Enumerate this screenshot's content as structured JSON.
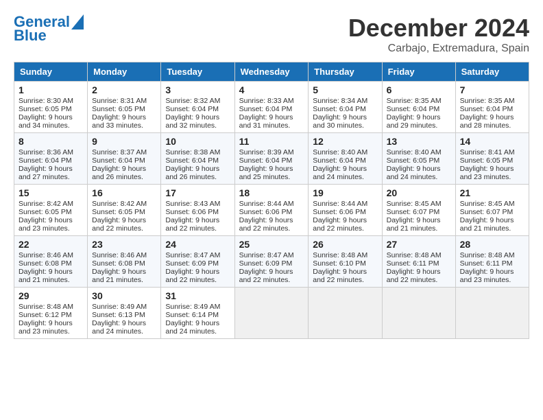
{
  "logo": {
    "line1": "General",
    "line2": "Blue"
  },
  "title": "December 2024",
  "location": "Carbajo, Extremadura, Spain",
  "days_of_week": [
    "Sunday",
    "Monday",
    "Tuesday",
    "Wednesday",
    "Thursday",
    "Friday",
    "Saturday"
  ],
  "weeks": [
    [
      {
        "day": "1",
        "lines": [
          "Sunrise: 8:30 AM",
          "Sunset: 6:05 PM",
          "Daylight: 9 hours",
          "and 34 minutes."
        ]
      },
      {
        "day": "2",
        "lines": [
          "Sunrise: 8:31 AM",
          "Sunset: 6:05 PM",
          "Daylight: 9 hours",
          "and 33 minutes."
        ]
      },
      {
        "day": "3",
        "lines": [
          "Sunrise: 8:32 AM",
          "Sunset: 6:04 PM",
          "Daylight: 9 hours",
          "and 32 minutes."
        ]
      },
      {
        "day": "4",
        "lines": [
          "Sunrise: 8:33 AM",
          "Sunset: 6:04 PM",
          "Daylight: 9 hours",
          "and 31 minutes."
        ]
      },
      {
        "day": "5",
        "lines": [
          "Sunrise: 8:34 AM",
          "Sunset: 6:04 PM",
          "Daylight: 9 hours",
          "and 30 minutes."
        ]
      },
      {
        "day": "6",
        "lines": [
          "Sunrise: 8:35 AM",
          "Sunset: 6:04 PM",
          "Daylight: 9 hours",
          "and 29 minutes."
        ]
      },
      {
        "day": "7",
        "lines": [
          "Sunrise: 8:35 AM",
          "Sunset: 6:04 PM",
          "Daylight: 9 hours",
          "and 28 minutes."
        ]
      }
    ],
    [
      {
        "day": "8",
        "lines": [
          "Sunrise: 8:36 AM",
          "Sunset: 6:04 PM",
          "Daylight: 9 hours",
          "and 27 minutes."
        ]
      },
      {
        "day": "9",
        "lines": [
          "Sunrise: 8:37 AM",
          "Sunset: 6:04 PM",
          "Daylight: 9 hours",
          "and 26 minutes."
        ]
      },
      {
        "day": "10",
        "lines": [
          "Sunrise: 8:38 AM",
          "Sunset: 6:04 PM",
          "Daylight: 9 hours",
          "and 26 minutes."
        ]
      },
      {
        "day": "11",
        "lines": [
          "Sunrise: 8:39 AM",
          "Sunset: 6:04 PM",
          "Daylight: 9 hours",
          "and 25 minutes."
        ]
      },
      {
        "day": "12",
        "lines": [
          "Sunrise: 8:40 AM",
          "Sunset: 6:04 PM",
          "Daylight: 9 hours",
          "and 24 minutes."
        ]
      },
      {
        "day": "13",
        "lines": [
          "Sunrise: 8:40 AM",
          "Sunset: 6:05 PM",
          "Daylight: 9 hours",
          "and 24 minutes."
        ]
      },
      {
        "day": "14",
        "lines": [
          "Sunrise: 8:41 AM",
          "Sunset: 6:05 PM",
          "Daylight: 9 hours",
          "and 23 minutes."
        ]
      }
    ],
    [
      {
        "day": "15",
        "lines": [
          "Sunrise: 8:42 AM",
          "Sunset: 6:05 PM",
          "Daylight: 9 hours",
          "and 23 minutes."
        ]
      },
      {
        "day": "16",
        "lines": [
          "Sunrise: 8:42 AM",
          "Sunset: 6:05 PM",
          "Daylight: 9 hours",
          "and 22 minutes."
        ]
      },
      {
        "day": "17",
        "lines": [
          "Sunrise: 8:43 AM",
          "Sunset: 6:06 PM",
          "Daylight: 9 hours",
          "and 22 minutes."
        ]
      },
      {
        "day": "18",
        "lines": [
          "Sunrise: 8:44 AM",
          "Sunset: 6:06 PM",
          "Daylight: 9 hours",
          "and 22 minutes."
        ]
      },
      {
        "day": "19",
        "lines": [
          "Sunrise: 8:44 AM",
          "Sunset: 6:06 PM",
          "Daylight: 9 hours",
          "and 22 minutes."
        ]
      },
      {
        "day": "20",
        "lines": [
          "Sunrise: 8:45 AM",
          "Sunset: 6:07 PM",
          "Daylight: 9 hours",
          "and 21 minutes."
        ]
      },
      {
        "day": "21",
        "lines": [
          "Sunrise: 8:45 AM",
          "Sunset: 6:07 PM",
          "Daylight: 9 hours",
          "and 21 minutes."
        ]
      }
    ],
    [
      {
        "day": "22",
        "lines": [
          "Sunrise: 8:46 AM",
          "Sunset: 6:08 PM",
          "Daylight: 9 hours",
          "and 21 minutes."
        ]
      },
      {
        "day": "23",
        "lines": [
          "Sunrise: 8:46 AM",
          "Sunset: 6:08 PM",
          "Daylight: 9 hours",
          "and 21 minutes."
        ]
      },
      {
        "day": "24",
        "lines": [
          "Sunrise: 8:47 AM",
          "Sunset: 6:09 PM",
          "Daylight: 9 hours",
          "and 22 minutes."
        ]
      },
      {
        "day": "25",
        "lines": [
          "Sunrise: 8:47 AM",
          "Sunset: 6:09 PM",
          "Daylight: 9 hours",
          "and 22 minutes."
        ]
      },
      {
        "day": "26",
        "lines": [
          "Sunrise: 8:48 AM",
          "Sunset: 6:10 PM",
          "Daylight: 9 hours",
          "and 22 minutes."
        ]
      },
      {
        "day": "27",
        "lines": [
          "Sunrise: 8:48 AM",
          "Sunset: 6:11 PM",
          "Daylight: 9 hours",
          "and 22 minutes."
        ]
      },
      {
        "day": "28",
        "lines": [
          "Sunrise: 8:48 AM",
          "Sunset: 6:11 PM",
          "Daylight: 9 hours",
          "and 23 minutes."
        ]
      }
    ],
    [
      {
        "day": "29",
        "lines": [
          "Sunrise: 8:48 AM",
          "Sunset: 6:12 PM",
          "Daylight: 9 hours",
          "and 23 minutes."
        ]
      },
      {
        "day": "30",
        "lines": [
          "Sunrise: 8:49 AM",
          "Sunset: 6:13 PM",
          "Daylight: 9 hours",
          "and 24 minutes."
        ]
      },
      {
        "day": "31",
        "lines": [
          "Sunrise: 8:49 AM",
          "Sunset: 6:14 PM",
          "Daylight: 9 hours",
          "and 24 minutes."
        ]
      },
      null,
      null,
      null,
      null
    ]
  ]
}
